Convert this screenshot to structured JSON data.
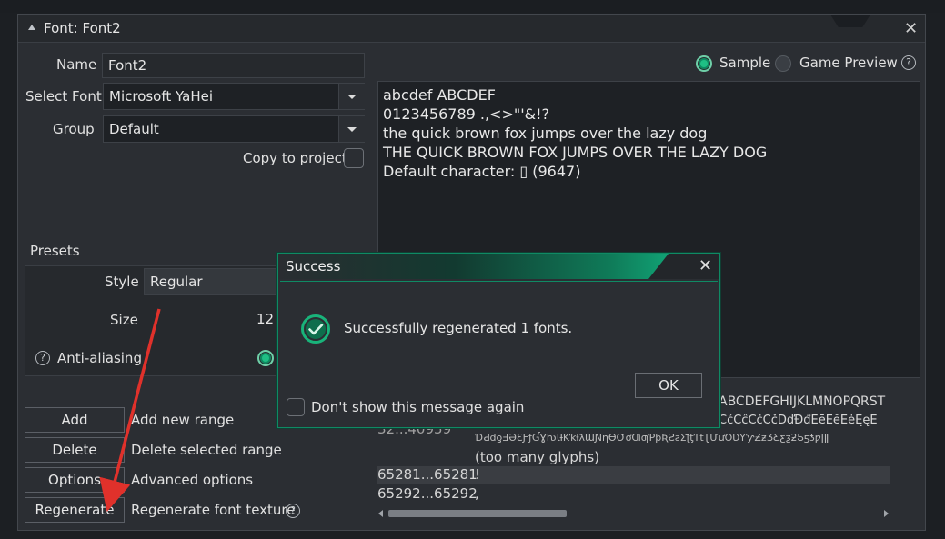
{
  "window": {
    "title": "Font: Font2"
  },
  "form": {
    "name_label": "Name",
    "name_value": "Font2",
    "select_font_label": "Select Font",
    "select_font_value": "Microsoft YaHei",
    "group_label": "Group",
    "group_value": "Default",
    "copy_label": "Copy to project"
  },
  "preview_mode": {
    "sample_label": "Sample",
    "game_preview_label": "Game Preview",
    "selected": "Sample"
  },
  "preview_text": [
    "abcdef ABCDEF",
    "0123456789 .,<>\"'&!?",
    "the quick brown fox jumps over the lazy dog",
    "THE QUICK BROWN FOX JUMPS OVER THE LAZY DOG",
    "Default character: ▯ (9647)"
  ],
  "presets": {
    "header": "Presets",
    "style_label": "Style",
    "style_value": "Regular",
    "size_label": "Size",
    "size_value": "12",
    "antialias_label": "Anti-aliasing"
  },
  "actions": [
    {
      "button": "Add",
      "desc": "Add new range"
    },
    {
      "button": "Delete",
      "desc": "Delete selected range"
    },
    {
      "button": "Options",
      "desc": "Advanced options"
    },
    {
      "button": "Regenerate",
      "desc": "Regenerate font texture"
    }
  ],
  "ranges": {
    "partial_glyphs_1": "ABCDEFGHIJKLMNOPQRST",
    "row_32_range": "32...40959",
    "row_32_glyphs": "ĆćĈĉĊċČčĎďĐđĒēĔĕĖėĘęĚ",
    "row_32_glyphs_2": "ƊƋƌƍƎƏƐƑƒƓƔƕƖƗƘƙƚƛƜƝƞƟƠơƢƣƤƥƦƧƨƩƪƫƬƭƮƯưƱƲƳƴƵƶƷƸƹƺƻƼƽƾƿǀǁ",
    "too_many": "(too many glyphs)",
    "rows": [
      {
        "range": "65281...65281",
        "glyph": "!"
      },
      {
        "range": "65292...65292",
        "glyph": ","
      }
    ]
  },
  "dialog": {
    "title": "Success",
    "message": "Successfully regenerated 1 fonts.",
    "ok_label": "OK",
    "dont_show_label": "Don't show this message again"
  },
  "colors": {
    "accent": "#0f8a64",
    "arrow": "#e0312b"
  }
}
